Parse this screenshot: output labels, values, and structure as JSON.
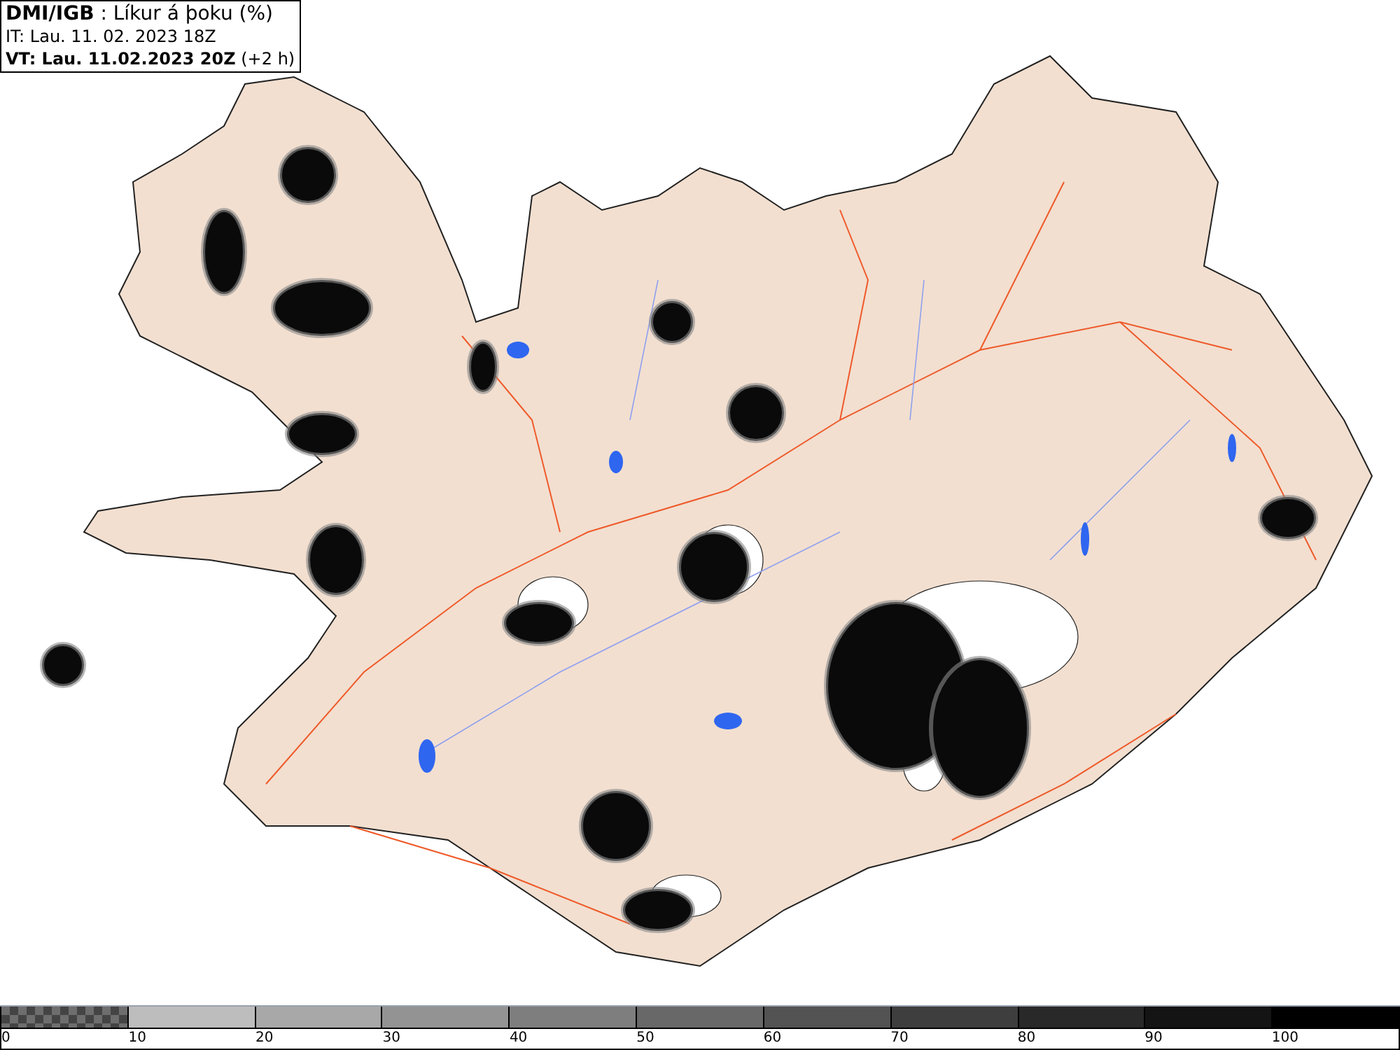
{
  "header": {
    "lines": [
      "**DMI/IGB** : Líkur á þoku (%)",
      "IT: Lau. 11. 02. 2023 18Z",
      "**VT: Lau. 11.02.2023 20Z** (+2 h)"
    ]
  },
  "legend": {
    "segments": [
      {
        "kind": "checker",
        "color": "#6e6e6e"
      },
      {
        "kind": "solid",
        "color": "#bdbdbd"
      },
      {
        "kind": "solid",
        "color": "#a8a8a8"
      },
      {
        "kind": "solid",
        "color": "#939393"
      },
      {
        "kind": "solid",
        "color": "#7e7e7e"
      },
      {
        "kind": "solid",
        "color": "#686868"
      },
      {
        "kind": "solid",
        "color": "#535353"
      },
      {
        "kind": "solid",
        "color": "#3e3e3e"
      },
      {
        "kind": "solid",
        "color": "#292929"
      },
      {
        "kind": "solid",
        "color": "#141414"
      },
      {
        "kind": "solid",
        "color": "#000000"
      }
    ],
    "labels": [
      "0",
      "10",
      "20",
      "30",
      "40",
      "50",
      "60",
      "70",
      "80",
      "90",
      "100"
    ]
  }
}
